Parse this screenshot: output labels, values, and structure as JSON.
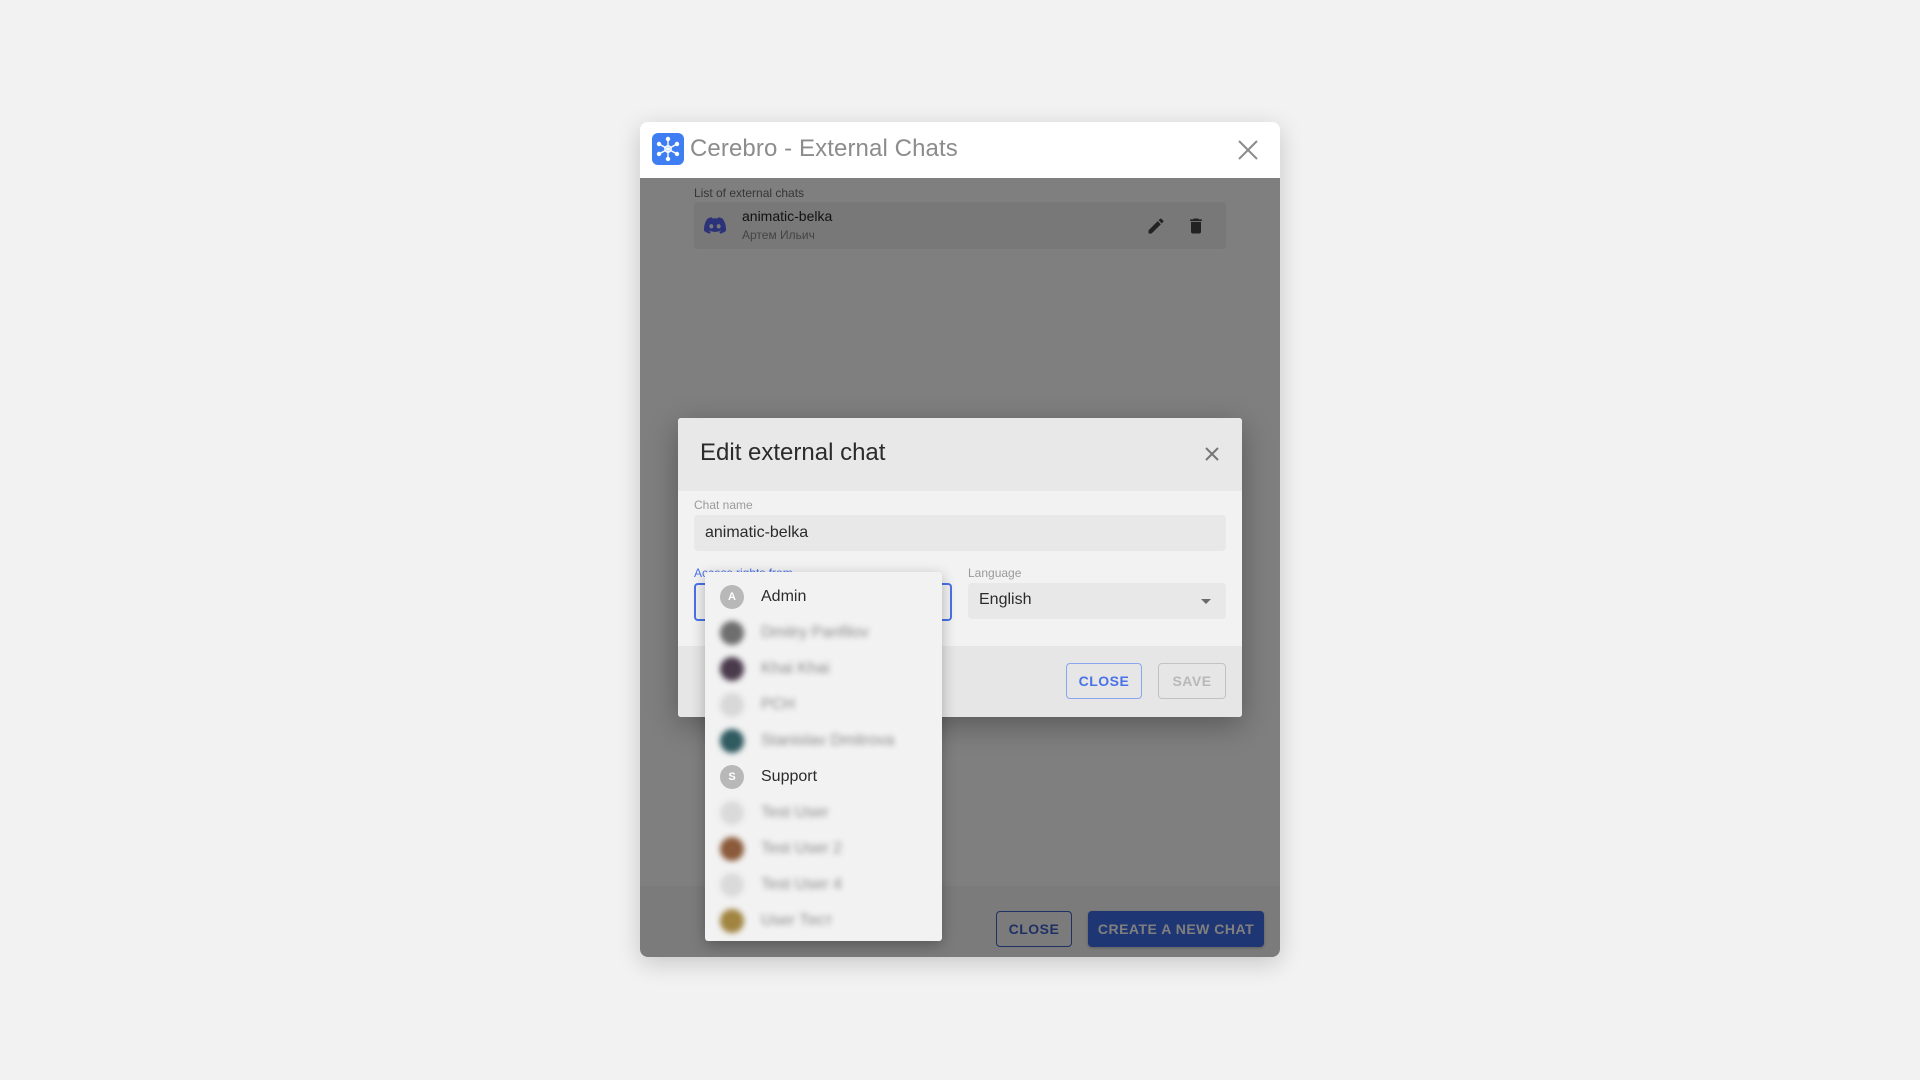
{
  "window": {
    "title": "Cerebro - External Chats",
    "logo_icon": "cerebro-logo-icon",
    "list_label": "List of external chats",
    "chats": [
      {
        "name": "animatic-belka",
        "owner": "Артем Ильич",
        "platform_icon": "discord-icon"
      }
    ],
    "footer": {
      "close_label": "CLOSE",
      "create_label": "CREATE A NEW CHAT"
    }
  },
  "dialog": {
    "title": "Edit external chat",
    "chat_name_label": "Chat name",
    "chat_name_value": "animatic-belka",
    "access_label": "Access rights from",
    "access_value": "",
    "language_label": "Language",
    "language_value": "English",
    "close_label": "CLOSE",
    "save_label": "SAVE"
  },
  "menu": {
    "items": [
      {
        "label": "Admin",
        "initial": "A",
        "avatar_color": "#b8b8b8",
        "blurred": false
      },
      {
        "label": "Dmitry Panfilov",
        "initial": "",
        "avatar_color": "#6e6e6e",
        "blurred": true
      },
      {
        "label": "Khai Khai",
        "initial": "",
        "avatar_color": "#4a3a4c",
        "blurred": true
      },
      {
        "label": "PCH",
        "initial": "",
        "avatar_color": "#d8d8d8",
        "blurred": true
      },
      {
        "label": "Stanislav Dmitrova",
        "initial": "",
        "avatar_color": "#2f5a60",
        "blurred": true
      },
      {
        "label": "Support",
        "initial": "S",
        "avatar_color": "#b8b8b8",
        "blurred": false
      },
      {
        "label": "Test User",
        "initial": "",
        "avatar_color": "#dadada",
        "blurred": true
      },
      {
        "label": "Test User 2",
        "initial": "",
        "avatar_color": "#8a5a3a",
        "blurred": true
      },
      {
        "label": "Test User 4",
        "initial": "",
        "avatar_color": "#dadada",
        "blurred": true
      },
      {
        "label": "User Тест",
        "initial": "",
        "avatar_color": "#a08440",
        "blurred": true
      }
    ]
  },
  "colors": {
    "accent": "#4a72e8",
    "primary_button": "#3f6ce8",
    "discord": "#5865f2",
    "logo": "#3f7ef2"
  }
}
